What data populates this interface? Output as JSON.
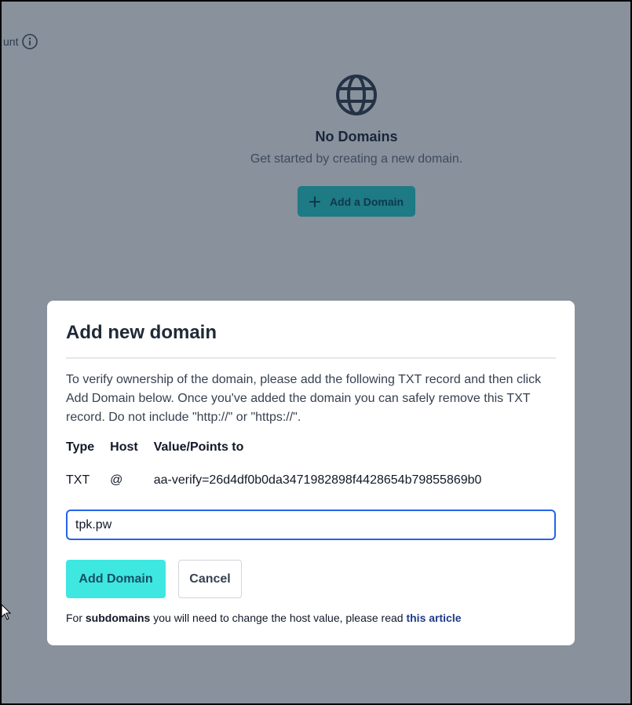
{
  "background": {
    "label_fragment": "unt",
    "info_icon": "info-circle-icon",
    "empty_state": {
      "icon": "globe-icon",
      "title": "No Domains",
      "subtitle": "Get started by creating a new domain.",
      "button_label": "Add a Domain",
      "button_icon": "plus-icon"
    }
  },
  "modal": {
    "title": "Add new domain",
    "description": "To verify ownership of the domain, please add the following TXT record and then click Add Domain below. Once you've added the domain you can safely remove this TXT record. Do not include \"http://\" or \"https://\".",
    "table": {
      "headers": [
        "Type",
        "Host",
        "Value/Points to"
      ],
      "row": [
        "TXT",
        "@",
        "aa-verify=26d4df0b0da3471982898f4428654b79855869b0"
      ]
    },
    "domain_input_value": "tpk.pw",
    "add_button_label": "Add Domain",
    "cancel_button_label": "Cancel",
    "footer": {
      "prefix": "For ",
      "bold": "subdomains",
      "middle": " you will need to change the host value, please read ",
      "link": "this article"
    }
  },
  "colors": {
    "overlay": "#11233a",
    "accent": "#3ee8e1",
    "input_border": "#2563eb",
    "link": "#1e3a8a"
  }
}
